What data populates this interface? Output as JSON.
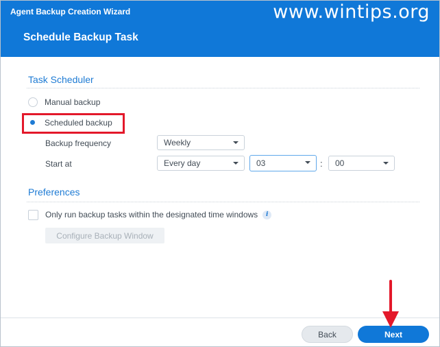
{
  "window": {
    "wizard_title": "Agent Backup Creation Wizard",
    "page_title": "Schedule Backup Task",
    "watermark": "www.wintips.org"
  },
  "task_scheduler": {
    "title": "Task Scheduler",
    "manual_label": "Manual backup",
    "scheduled_label": "Scheduled backup",
    "selected": "Scheduled backup",
    "frequency_label": "Backup frequency",
    "frequency_value": "Weekly",
    "start_label": "Start at",
    "start_day_value": "Every day",
    "start_hour_value": "03",
    "start_minute_value": "00",
    "time_separator": ":"
  },
  "preferences": {
    "title": "Preferences",
    "time_window_label": "Only run backup tasks within the designated time windows",
    "time_window_checked": false,
    "configure_button": "Configure Backup Window"
  },
  "footer": {
    "back_label": "Back",
    "next_label": "Next"
  },
  "annotation": {
    "highlight_color": "#e3182a",
    "arrow_color": "#e3182a"
  },
  "colors": {
    "accent": "#1078d8",
    "section_title": "#1e7bd4"
  },
  "icons": {
    "info": "info-icon",
    "dropdown": "chevron-down-icon"
  }
}
